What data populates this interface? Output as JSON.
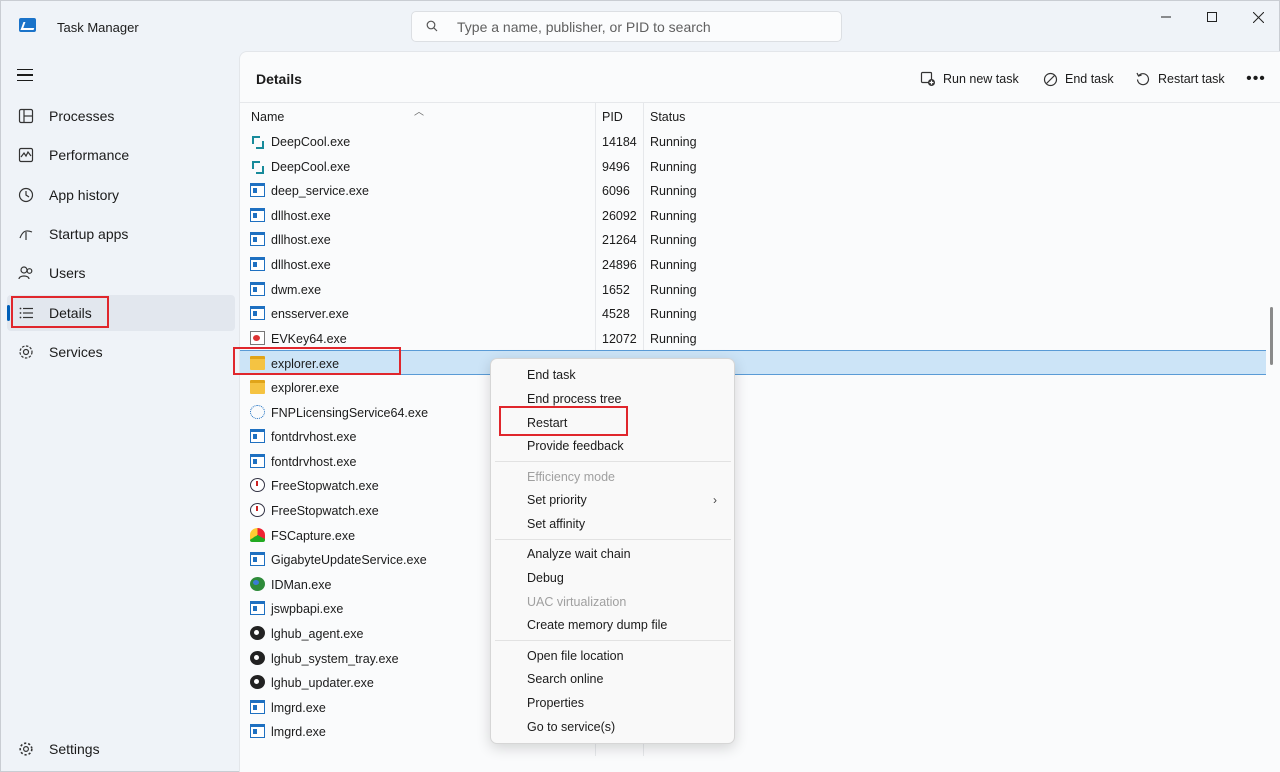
{
  "window": {
    "title": "Task Manager",
    "search_placeholder": "Type a name, publisher, or PID to search",
    "controls": [
      "minimize",
      "maximize",
      "close"
    ]
  },
  "sidebar": {
    "items": [
      {
        "label": "Processes",
        "icon": "processes-icon"
      },
      {
        "label": "Performance",
        "icon": "performance-icon"
      },
      {
        "label": "App history",
        "icon": "app-history-icon"
      },
      {
        "label": "Startup apps",
        "icon": "startup-icon"
      },
      {
        "label": "Users",
        "icon": "users-icon"
      },
      {
        "label": "Details",
        "icon": "details-icon",
        "active": true
      },
      {
        "label": "Services",
        "icon": "services-icon"
      }
    ],
    "settings_label": "Settings"
  },
  "header": {
    "title": "Details",
    "run_new_task": "Run new task",
    "end_task": "End task",
    "restart_task": "Restart task"
  },
  "table": {
    "columns": [
      "Name",
      "PID",
      "Status"
    ],
    "rows": [
      {
        "name": "DeepCool.exe",
        "pid": "14184",
        "status": "Running",
        "icon": "deep"
      },
      {
        "name": "DeepCool.exe",
        "pid": "9496",
        "status": "Running",
        "icon": "deep"
      },
      {
        "name": "deep_service.exe",
        "pid": "6096",
        "status": "Running",
        "icon": "exe"
      },
      {
        "name": "dllhost.exe",
        "pid": "26092",
        "status": "Running",
        "icon": "exe"
      },
      {
        "name": "dllhost.exe",
        "pid": "21264",
        "status": "Running",
        "icon": "exe"
      },
      {
        "name": "dllhost.exe",
        "pid": "24896",
        "status": "Running",
        "icon": "exe"
      },
      {
        "name": "dwm.exe",
        "pid": "1652",
        "status": "Running",
        "icon": "exe"
      },
      {
        "name": "ensserver.exe",
        "pid": "4528",
        "status": "Running",
        "icon": "exe"
      },
      {
        "name": "EVKey64.exe",
        "pid": "12072",
        "status": "Running",
        "icon": "evkey"
      },
      {
        "name": "explorer.exe",
        "pid": "",
        "status": "",
        "icon": "folder",
        "selected": true
      },
      {
        "name": "explorer.exe",
        "pid": "",
        "status": "",
        "icon": "folder"
      },
      {
        "name": "FNPLicensingService64.exe",
        "pid": "",
        "status": "",
        "icon": "fnp"
      },
      {
        "name": "fontdrvhost.exe",
        "pid": "",
        "status": "",
        "icon": "exe"
      },
      {
        "name": "fontdrvhost.exe",
        "pid": "",
        "status": "",
        "icon": "exe"
      },
      {
        "name": "FreeStopwatch.exe",
        "pid": "",
        "status": "",
        "icon": "clock"
      },
      {
        "name": "FreeStopwatch.exe",
        "pid": "",
        "status": "",
        "icon": "clock"
      },
      {
        "name": "FSCapture.exe",
        "pid": "",
        "status": "",
        "icon": "fsc"
      },
      {
        "name": "GigabyteUpdateService.exe",
        "pid": "",
        "status": "",
        "icon": "exe"
      },
      {
        "name": "IDMan.exe",
        "pid": "",
        "status": "",
        "icon": "globe"
      },
      {
        "name": "jswpbapi.exe",
        "pid": "",
        "status": "",
        "icon": "exe"
      },
      {
        "name": "lghub_agent.exe",
        "pid": "",
        "status": "",
        "icon": "g"
      },
      {
        "name": "lghub_system_tray.exe",
        "pid": "",
        "status": "",
        "icon": "g"
      },
      {
        "name": "lghub_updater.exe",
        "pid": "",
        "status": "",
        "icon": "g"
      },
      {
        "name": "lmgrd.exe",
        "pid": "",
        "status": "",
        "icon": "exe"
      },
      {
        "name": "lmgrd.exe",
        "pid": "",
        "status": "",
        "icon": "exe"
      }
    ]
  },
  "context_menu": {
    "groups": [
      [
        {
          "label": "End task"
        },
        {
          "label": "End process tree"
        },
        {
          "label": "Restart"
        },
        {
          "label": "Provide feedback"
        }
      ],
      [
        {
          "label": "Efficiency mode",
          "disabled": true
        },
        {
          "label": "Set priority",
          "submenu": true
        },
        {
          "label": "Set affinity"
        }
      ],
      [
        {
          "label": "Analyze wait chain"
        },
        {
          "label": "Debug"
        },
        {
          "label": "UAC virtualization",
          "disabled": true
        },
        {
          "label": "Create memory dump file"
        }
      ],
      [
        {
          "label": "Open file location"
        },
        {
          "label": "Search online"
        },
        {
          "label": "Properties"
        },
        {
          "label": "Go to service(s)"
        }
      ]
    ]
  },
  "colors": {
    "accent": "#005fb8",
    "selection": "#cce4f7",
    "highlight_box": "#e0262c"
  }
}
